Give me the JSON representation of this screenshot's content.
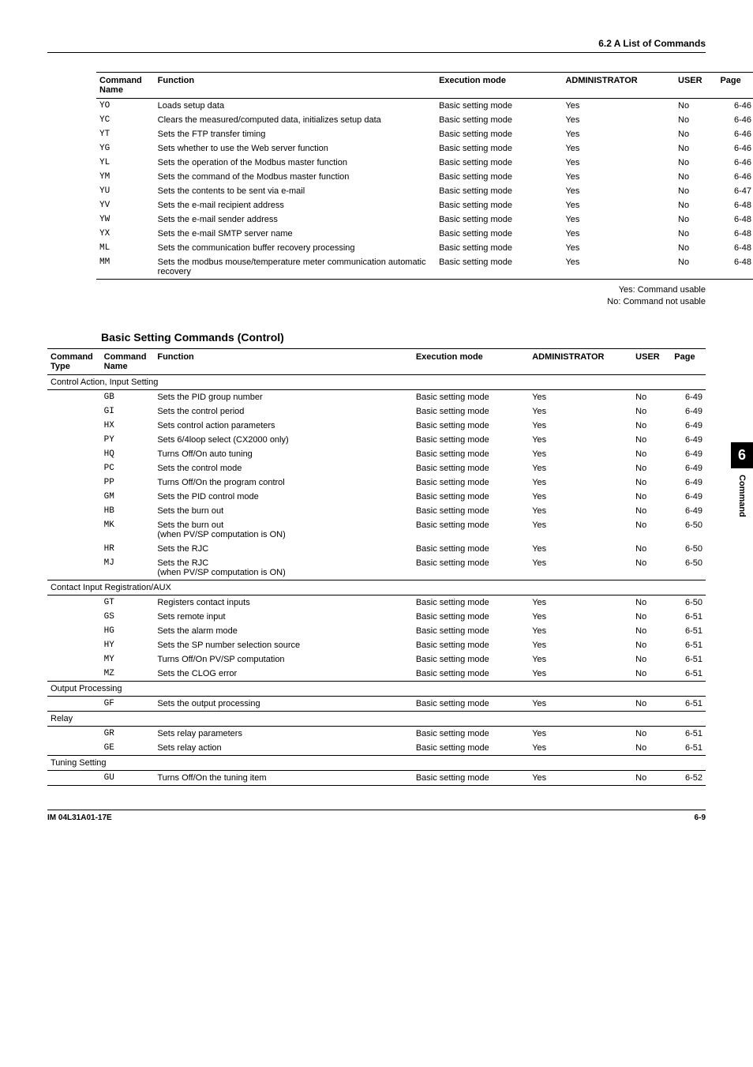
{
  "header": {
    "section_title": "6.2 A List of Commands"
  },
  "table1": {
    "headers": {
      "command": "Command",
      "name": "Name",
      "function": "Function",
      "exec_mode": "Execution mode",
      "admin": "ADMINISTRATOR",
      "user": "USER",
      "page": "Page"
    },
    "rows": [
      {
        "cmd": "YO",
        "func": "Loads setup data",
        "mode": "Basic setting mode",
        "admin": "Yes",
        "user": "No",
        "page": "6-46"
      },
      {
        "cmd": "YC",
        "func": "Clears the measured/computed data, initializes setup data",
        "mode": "Basic setting mode",
        "admin": "Yes",
        "user": "No",
        "page": "6-46"
      },
      {
        "cmd": "YT",
        "func": "Sets the FTP transfer timing",
        "mode": "Basic setting mode",
        "admin": "Yes",
        "user": "No",
        "page": "6-46"
      },
      {
        "cmd": "YG",
        "func": "Sets whether to use the Web server function",
        "mode": "Basic setting mode",
        "admin": "Yes",
        "user": "No",
        "page": "6-46"
      },
      {
        "cmd": "YL",
        "func": "Sets the operation of the Modbus master function",
        "mode": "Basic setting mode",
        "admin": "Yes",
        "user": "No",
        "page": "6-46"
      },
      {
        "cmd": "YM",
        "func": "Sets the command of the Modbus master function",
        "mode": "Basic setting mode",
        "admin": "Yes",
        "user": "No",
        "page": "6-46"
      },
      {
        "cmd": "YU",
        "func": "Sets the contents to be sent via e-mail",
        "mode": "Basic setting mode",
        "admin": "Yes",
        "user": "No",
        "page": "6-47"
      },
      {
        "cmd": "YV",
        "func": "Sets the e-mail recipient address",
        "mode": "Basic setting mode",
        "admin": "Yes",
        "user": "No",
        "page": "6-48"
      },
      {
        "cmd": "YW",
        "func": "Sets the e-mail sender address",
        "mode": "Basic setting mode",
        "admin": "Yes",
        "user": "No",
        "page": "6-48"
      },
      {
        "cmd": "YX",
        "func": "Sets the e-mail SMTP server name",
        "mode": "Basic setting mode",
        "admin": "Yes",
        "user": "No",
        "page": "6-48"
      },
      {
        "cmd": "ML",
        "func": "Sets the communication buffer recovery processing",
        "mode": "Basic setting mode",
        "admin": "Yes",
        "user": "No",
        "page": "6-48"
      },
      {
        "cmd": "MM",
        "func": "Sets the modbus mouse/temperature meter communication automatic recovery",
        "mode": "Basic setting mode",
        "admin": "Yes",
        "user": "No",
        "page": "6-48"
      }
    ]
  },
  "notes": {
    "line1": "Yes: Command usable",
    "line2": "No: Command not usable"
  },
  "subheading": "Basic Setting Commands (Control)",
  "table2": {
    "headers": {
      "type": "Command Type",
      "command": "Command",
      "name": "Name",
      "function": "Function",
      "exec_mode": "Execution mode",
      "admin": "ADMINISTRATOR",
      "user": "USER",
      "page": "Page"
    },
    "groups": [
      {
        "title": "Control Action, Input Setting",
        "rows": [
          {
            "cmd": "GB",
            "func": "Sets the PID group number",
            "mode": "Basic setting mode",
            "admin": "Yes",
            "user": "No",
            "page": "6-49"
          },
          {
            "cmd": "GI",
            "func": "Sets the control period",
            "mode": "Basic setting mode",
            "admin": "Yes",
            "user": "No",
            "page": "6-49"
          },
          {
            "cmd": "HX",
            "func": "Sets control action parameters",
            "mode": "Basic setting mode",
            "admin": "Yes",
            "user": "No",
            "page": "6-49"
          },
          {
            "cmd": "PY",
            "func": "Sets 6/4loop select (CX2000 only)",
            "mode": "Basic setting mode",
            "admin": "Yes",
            "user": "No",
            "page": "6-49"
          },
          {
            "cmd": "HQ",
            "func": "Turns Off/On auto tuning",
            "mode": "Basic setting mode",
            "admin": "Yes",
            "user": "No",
            "page": "6-49"
          },
          {
            "cmd": "PC",
            "func": "Sets the control mode",
            "mode": "Basic setting mode",
            "admin": "Yes",
            "user": "No",
            "page": "6-49"
          },
          {
            "cmd": "PP",
            "func": "Turns Off/On the program control",
            "mode": "Basic setting mode",
            "admin": "Yes",
            "user": "No",
            "page": "6-49"
          },
          {
            "cmd": "GM",
            "func": "Sets the PID control mode",
            "mode": "Basic setting mode",
            "admin": "Yes",
            "user": "No",
            "page": "6-49"
          },
          {
            "cmd": "HB",
            "func": "Sets the burn out",
            "mode": "Basic setting mode",
            "admin": "Yes",
            "user": "No",
            "page": "6-49"
          },
          {
            "cmd": "MK",
            "func": "Sets the burn out\n(when PV/SP computation is ON)",
            "mode": "Basic setting mode",
            "admin": "Yes",
            "user": "No",
            "page": "6-50"
          },
          {
            "cmd": "HR",
            "func": "Sets the RJC",
            "mode": "Basic setting mode",
            "admin": "Yes",
            "user": "No",
            "page": "6-50"
          },
          {
            "cmd": "MJ",
            "func": "Sets the RJC\n(when PV/SP computation is ON)",
            "mode": "Basic setting mode",
            "admin": "Yes",
            "user": "No",
            "page": "6-50"
          }
        ]
      },
      {
        "title": "Contact Input Registration/AUX",
        "rows": [
          {
            "cmd": "GT",
            "func": "Registers contact inputs",
            "mode": "Basic setting mode",
            "admin": "Yes",
            "user": "No",
            "page": "6-50"
          },
          {
            "cmd": "GS",
            "func": "Sets remote input",
            "mode": "Basic setting mode",
            "admin": "Yes",
            "user": "No",
            "page": "6-51"
          },
          {
            "cmd": "HG",
            "func": "Sets the alarm mode",
            "mode": "Basic setting mode",
            "admin": "Yes",
            "user": "No",
            "page": "6-51"
          },
          {
            "cmd": "HY",
            "func": "Sets the SP number selection source",
            "mode": "Basic setting mode",
            "admin": "Yes",
            "user": "No",
            "page": "6-51"
          },
          {
            "cmd": "MY",
            "func": "Turns Off/On PV/SP computation",
            "mode": "Basic setting mode",
            "admin": "Yes",
            "user": "No",
            "page": "6-51"
          },
          {
            "cmd": "MZ",
            "func": "Sets the CLOG error",
            "mode": "Basic setting mode",
            "admin": "Yes",
            "user": "No",
            "page": "6-51"
          }
        ]
      },
      {
        "title": "Output Processing",
        "rows": [
          {
            "cmd": "GF",
            "func": "Sets the output processing",
            "mode": "Basic setting mode",
            "admin": "Yes",
            "user": "No",
            "page": "6-51"
          }
        ]
      },
      {
        "title": "Relay",
        "rows": [
          {
            "cmd": "GR",
            "func": "Sets relay parameters",
            "mode": "Basic setting mode",
            "admin": "Yes",
            "user": "No",
            "page": "6-51"
          },
          {
            "cmd": "GE",
            "func": "Sets relay action",
            "mode": "Basic setting mode",
            "admin": "Yes",
            "user": "No",
            "page": "6-51"
          }
        ]
      },
      {
        "title": "Tuning Setting",
        "rows": [
          {
            "cmd": "GU",
            "func": "Turns Off/On the tuning item",
            "mode": "Basic setting mode",
            "admin": "Yes",
            "user": "No",
            "page": "6-52"
          }
        ]
      }
    ]
  },
  "side_tab": {
    "number": "6",
    "label": "Command"
  },
  "footer": {
    "left": "IM 04L31A01-17E",
    "right": "6-9"
  }
}
